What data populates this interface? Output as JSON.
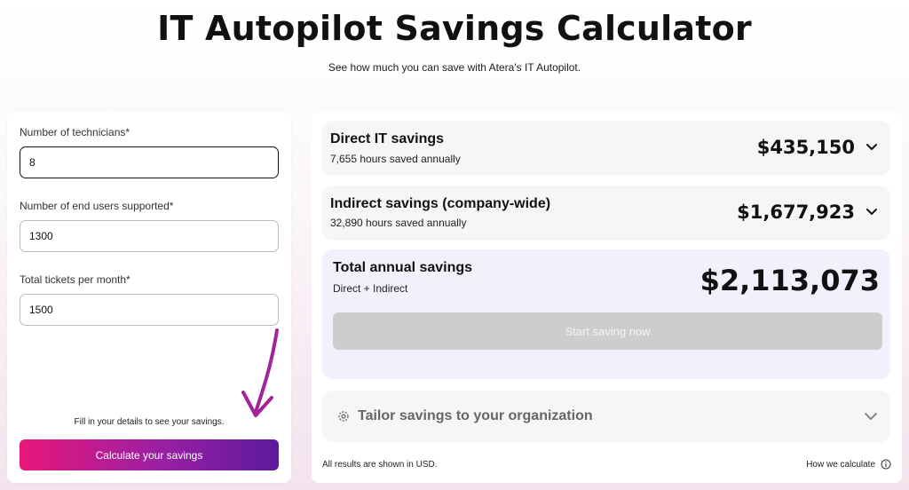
{
  "header": {
    "title": "IT Autopilot Savings Calculator",
    "subtitle": "See how much you can save with Atera's IT Autopilot."
  },
  "form": {
    "technicians": {
      "label": "Number of technicians*",
      "value": "8"
    },
    "end_users": {
      "label": "Number of end users supported*",
      "value": "1300"
    },
    "tickets": {
      "label": "Total tickets per month*",
      "value": "1500"
    },
    "hint": "Fill in your details to see your savings.",
    "submit_label": "Calculate your savings"
  },
  "results": {
    "direct": {
      "title": "Direct IT savings",
      "sub": "7,655 hours saved annually",
      "amount": "$435,150"
    },
    "indirect": {
      "title": "Indirect savings (company-wide)",
      "sub": "32,890 hours saved annually",
      "amount": "$1,677,923"
    },
    "total": {
      "title": "Total annual savings",
      "sub": "Direct + Indirect",
      "amount": "$2,113,073",
      "cta": "Start saving now"
    },
    "tailor_label": "Tailor savings to your organization",
    "currency_note": "All results are shown in USD.",
    "how_label": "How we calculate"
  },
  "icons": {
    "chevron": "chevron-down-icon",
    "gear": "gear-icon",
    "info": "info-icon",
    "arrow": "hand-drawn-arrow"
  },
  "colors": {
    "button_gradient_start": "#e8177a",
    "button_gradient_end": "#5c1a9e",
    "arrow": "#a3239b",
    "total_card_bg": "#f4effc"
  }
}
